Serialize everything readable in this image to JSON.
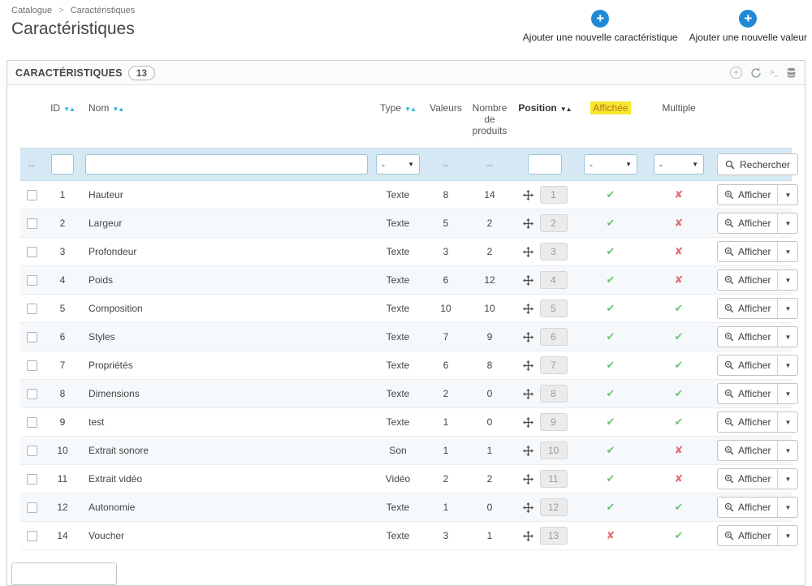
{
  "colors": {
    "accent_blue": "#2089d5",
    "sort_teal": "#25b9d7",
    "success_green": "#72c279",
    "danger_red": "#e26e77",
    "highlight_yellow": "#f6e72f",
    "filter_row_bg": "#d6e8f3"
  },
  "breadcrumb": {
    "items": [
      "Catalogue",
      "Caractéristiques"
    ],
    "separator": ">"
  },
  "page": {
    "title": "Caractéristiques"
  },
  "header_actions": [
    {
      "label": "Ajouter une nouvelle caractéristique",
      "icon": "add-icon"
    },
    {
      "label": "Ajouter une nouvelle valeur",
      "icon": "add-icon"
    }
  ],
  "panel": {
    "title": "CARACTÉRISTIQUES",
    "count": "13",
    "toolbar_icons": [
      "add-icon",
      "refresh-icon",
      "terminal-icon",
      "database-icon"
    ]
  },
  "table": {
    "columns": {
      "id": "ID",
      "nom": "Nom",
      "type": "Type",
      "valeurs": "Valeurs",
      "produits": "Nombre de produits",
      "position": "Position",
      "affichee": "Affichée",
      "multiple": "Multiple"
    },
    "filter": {
      "empty": "--",
      "select_placeholder": "-",
      "search_label": "Rechercher"
    },
    "action_label": "Afficher",
    "rows": [
      {
        "id": "1",
        "nom": "Hauteur",
        "type": "Texte",
        "valeurs": "8",
        "produits": "14",
        "position": "1",
        "affichee": true,
        "multiple": false
      },
      {
        "id": "2",
        "nom": "Largeur",
        "type": "Texte",
        "valeurs": "5",
        "produits": "2",
        "position": "2",
        "affichee": true,
        "multiple": false
      },
      {
        "id": "3",
        "nom": "Profondeur",
        "type": "Texte",
        "valeurs": "3",
        "produits": "2",
        "position": "3",
        "affichee": true,
        "multiple": false
      },
      {
        "id": "4",
        "nom": "Poids",
        "type": "Texte",
        "valeurs": "6",
        "produits": "12",
        "position": "4",
        "affichee": true,
        "multiple": false
      },
      {
        "id": "5",
        "nom": "Composition",
        "type": "Texte",
        "valeurs": "10",
        "produits": "10",
        "position": "5",
        "affichee": true,
        "multiple": true
      },
      {
        "id": "6",
        "nom": "Styles",
        "type": "Texte",
        "valeurs": "7",
        "produits": "9",
        "position": "6",
        "affichee": true,
        "multiple": true
      },
      {
        "id": "7",
        "nom": "Propriétés",
        "type": "Texte",
        "valeurs": "6",
        "produits": "8",
        "position": "7",
        "affichee": true,
        "multiple": true
      },
      {
        "id": "8",
        "nom": "Dimensions",
        "type": "Texte",
        "valeurs": "2",
        "produits": "0",
        "position": "8",
        "affichee": true,
        "multiple": true
      },
      {
        "id": "9",
        "nom": "test",
        "type": "Texte",
        "valeurs": "1",
        "produits": "0",
        "position": "9",
        "affichee": true,
        "multiple": true
      },
      {
        "id": "10",
        "nom": "Extrait sonore",
        "type": "Son",
        "valeurs": "1",
        "produits": "1",
        "position": "10",
        "affichee": true,
        "multiple": false
      },
      {
        "id": "11",
        "nom": "Extrait vidéo",
        "type": "Vidéo",
        "valeurs": "2",
        "produits": "2",
        "position": "11",
        "affichee": true,
        "multiple": false
      },
      {
        "id": "12",
        "nom": "Autonomie",
        "type": "Texte",
        "valeurs": "1",
        "produits": "0",
        "position": "12",
        "affichee": true,
        "multiple": true
      },
      {
        "id": "14",
        "nom": "Voucher",
        "type": "Texte",
        "valeurs": "3",
        "produits": "1",
        "position": "13",
        "affichee": false,
        "multiple": true
      }
    ]
  }
}
